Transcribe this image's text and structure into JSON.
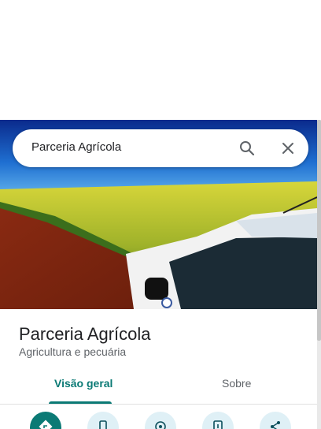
{
  "search": {
    "query": "Parceria Agrícola"
  },
  "place": {
    "name": "Parceria Agrícola",
    "category": "Agricultura e pecuária"
  },
  "tabs": [
    {
      "label": "Visão geral",
      "active": true
    },
    {
      "label": "Sobre",
      "active": false
    }
  ],
  "actions": [
    {
      "icon": "directions-icon"
    },
    {
      "icon": "phone-icon"
    },
    {
      "icon": "nearby-icon"
    },
    {
      "icon": "send-to-phone-icon"
    },
    {
      "icon": "share-icon"
    }
  ],
  "colors": {
    "accent": "#0b7a75",
    "action_bg": "#dff0f6"
  }
}
